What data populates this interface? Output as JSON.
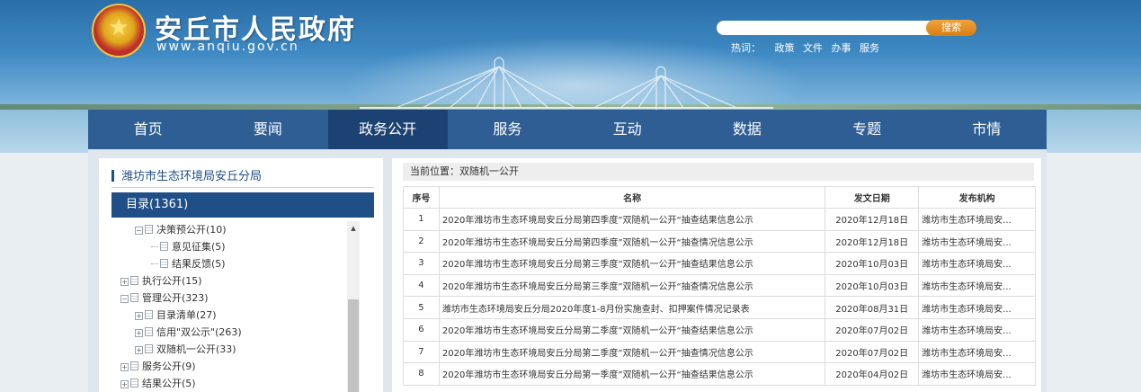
{
  "header": {
    "site_title": "安丘市人民政府",
    "site_url": "www.anqiu.gov.cn",
    "search_placeholder": "",
    "search_button": "搜索",
    "hotwords_label": "热词：",
    "hotwords": [
      "政策",
      "文件",
      "办事",
      "服务"
    ]
  },
  "nav": {
    "items": [
      {
        "label": "首页"
      },
      {
        "label": "要闻"
      },
      {
        "label": "政务公开"
      },
      {
        "label": "服务"
      },
      {
        "label": "互动"
      },
      {
        "label": "数据"
      },
      {
        "label": "专题"
      },
      {
        "label": "市情"
      }
    ],
    "active_index": 2
  },
  "sidebar": {
    "dept_title": "潍坊市生态环境局安丘分局",
    "catalog_label": "目录(1361)",
    "tree": [
      {
        "label": "决策预公开(10)",
        "level": 2,
        "expand": "minus"
      },
      {
        "label": "意见征集(5)",
        "level": 3,
        "expand": "none"
      },
      {
        "label": "结果反馈(5)",
        "level": 3,
        "expand": "none"
      },
      {
        "label": "执行公开(15)",
        "level": 1,
        "expand": "plus"
      },
      {
        "label": "管理公开(323)",
        "level": 1,
        "expand": "minus"
      },
      {
        "label": "目录清单(27)",
        "level": 2,
        "expand": "plus"
      },
      {
        "label": "信用\"双公示\"(263)",
        "level": 2,
        "expand": "plus"
      },
      {
        "label": "双随机一公开(33)",
        "level": 2,
        "expand": "plus"
      },
      {
        "label": "服务公开(9)",
        "level": 1,
        "expand": "plus"
      },
      {
        "label": "结果公开(5)",
        "level": 1,
        "expand": "plus"
      }
    ]
  },
  "main": {
    "breadcrumb": "当前位置：双随机一公开",
    "columns": [
      "序号",
      "名称",
      "发文日期",
      "发布机构"
    ],
    "rows": [
      {
        "idx": "1",
        "name": "2020年潍坊市生态环境局安丘分局第四季度”双随机一公开“抽查结果信息公示",
        "date": "2020年12月18日",
        "org": "潍坊市生态环境局安..."
      },
      {
        "idx": "2",
        "name": "2020年潍坊市生态环境局安丘分局第四季度”双随机一公开“抽查情况信息公示",
        "date": "2020年12月18日",
        "org": "潍坊市生态环境局安..."
      },
      {
        "idx": "3",
        "name": "2020年潍坊市生态环境局安丘分局第三季度”双随机一公开“抽查结果信息公示",
        "date": "2020年10月03日",
        "org": "潍坊市生态环境局安..."
      },
      {
        "idx": "4",
        "name": "2020年潍坊市生态环境局安丘分局第三季度”双随机一公开“抽查情况信息公示",
        "date": "2020年10月03日",
        "org": "潍坊市生态环境局安..."
      },
      {
        "idx": "5",
        "name": "潍坊市生态环境局安丘分局2020年度1-8月份实施查封、扣押案件情况记录表",
        "date": "2020年08月31日",
        "org": "潍坊市生态环境局安..."
      },
      {
        "idx": "6",
        "name": "2020年潍坊市生态环境局安丘分局第二季度”双随机一公开“抽查结果信息公示",
        "date": "2020年07月02日",
        "org": "潍坊市生态环境局安..."
      },
      {
        "idx": "7",
        "name": "2020年潍坊市生态环境局安丘分局第二季度”双随机一公开“抽查情况信息公示",
        "date": "2020年07月02日",
        "org": "潍坊市生态环境局安..."
      },
      {
        "idx": "8",
        "name": "2020年潍坊市生态环境局安丘分局第一季度”双随机一公开“抽查结果信息公示",
        "date": "2020年04月02日",
        "org": "潍坊市生态环境局安..."
      }
    ]
  },
  "colors": {
    "nav_bg": "#2e5e94",
    "nav_active": "#1c4273",
    "catalog_bg": "#1f4f86",
    "search_btn": "#e08a1e"
  }
}
